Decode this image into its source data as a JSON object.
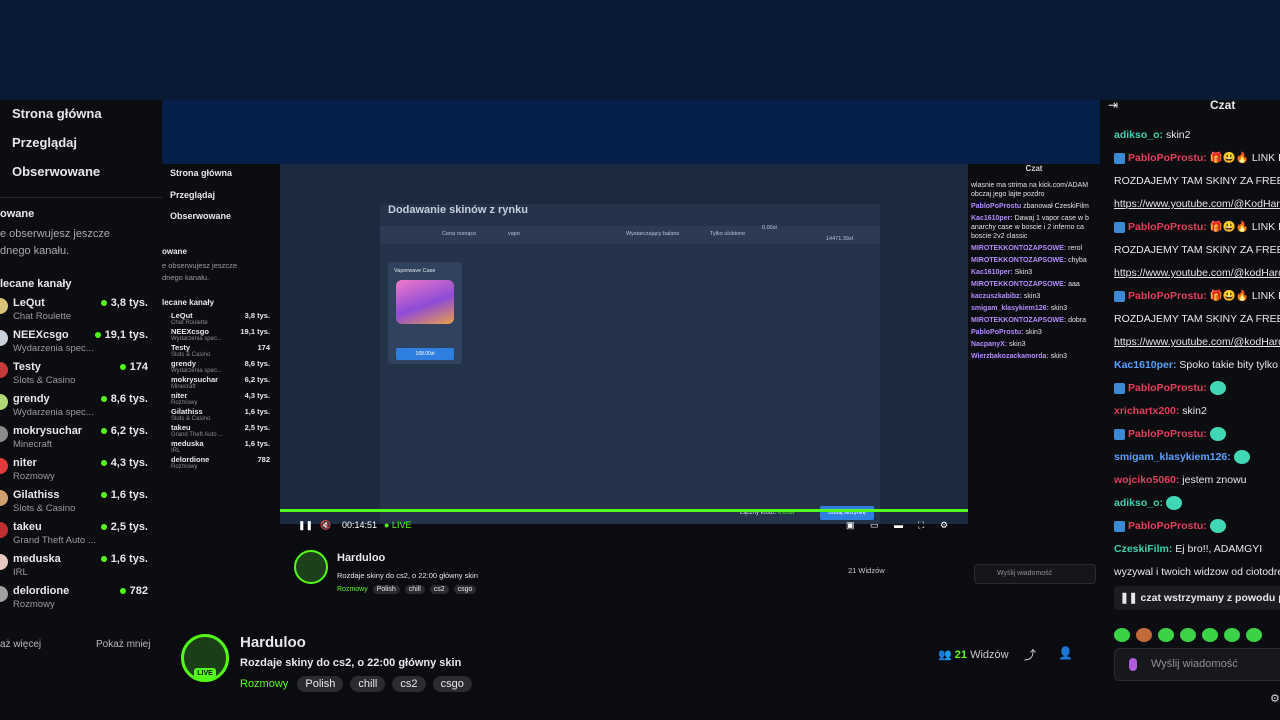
{
  "nav": {
    "home": "Strona główna",
    "browse": "Przeglądaj",
    "following": "Obserwowane"
  },
  "sidebar": {
    "followed_heading": "Obserwowane",
    "followed_empty": "Nie obserwujesz jeszcze żadnego kanału.",
    "followed_empty_line1": "e obserwujesz jeszcze",
    "followed_empty_line2": "dnego kanału.",
    "followed_heading_cut": "owane",
    "recommended_heading": "lecane kanały",
    "show_more": "aż więcej",
    "show_less": "Pokaż mniej",
    "recommended": [
      {
        "name": "LeQut",
        "category": "Chat Roulette",
        "viewers": "3,8 tys.",
        "avatar": "#d8c27a"
      },
      {
        "name": "NEEXcsgo",
        "category": "Wydarzenia spec...",
        "viewers": "19,1 tys.",
        "avatar": "#c9d1db"
      },
      {
        "name": "Testy",
        "category": "Slots & Casino",
        "viewers": "174",
        "avatar": "#c73a3a"
      },
      {
        "name": "grendy",
        "category": "Wydarzenia spec...",
        "viewers": "8,6 tys.",
        "avatar": "#b2d87a"
      },
      {
        "name": "mokrysuchar",
        "category": "Minecraft",
        "viewers": "6,2 tys.",
        "avatar": "#8a8a8a"
      },
      {
        "name": "niter",
        "category": "Rozmowy",
        "viewers": "4,3 tys.",
        "avatar": "#e03a3a"
      },
      {
        "name": "Gilathiss",
        "category": "Slots & Casino",
        "viewers": "1,6 tys.",
        "avatar": "#d0a070"
      },
      {
        "name": "takeu",
        "category": "Grand Theft Auto ...",
        "viewers": "2,5 tys.",
        "avatar": "#c03030"
      },
      {
        "name": "meduska",
        "category": "IRL",
        "viewers": "1,6 tys.",
        "avatar": "#e8c8c0"
      },
      {
        "name": "delordione",
        "category": "Rozmowy",
        "viewers": "782",
        "avatar": "#a0a0a0"
      }
    ]
  },
  "inner": {
    "modal_title": "Dodawanie skinów z rynku",
    "toolbar": [
      "Cena rosnąco",
      "vapo",
      "Wystarczający balans",
      "Tylko ulubione"
    ],
    "slider_min": "0.00zł",
    "slider_max": "14471.39zł",
    "case_name": "Vaporwave Case",
    "case_price": "168.00zł",
    "total_label": "Łączny koszt:",
    "total_value": "0.00zł",
    "add_button": "Dodaj skrzynkę",
    "time": "00:14:51",
    "live": "● LIVE",
    "chat_title": "Czat",
    "chat": [
      {
        "user": "",
        "text": "wlasnie ma strima na kick.com/ADAM obczaj jego lajte pozdro"
      },
      {
        "user": "PabloPoProstu",
        "text": "zbanował CzeskiFilm"
      },
      {
        "user": "Kac1610per:",
        "text": "Dawaj 1 vapor case w b anarchy case w boscie i 2 inferno ca boscie 2v2 classic"
      },
      {
        "user": "MIROTEKKONTOZAPSOWE:",
        "text": "rerol"
      },
      {
        "user": "MIROTEKKONTOZAPSOWE:",
        "text": "chyba"
      },
      {
        "user": "Kac1610per:",
        "text": "Skin3"
      },
      {
        "user": "MIROTEKKONTOZAPSOWE:",
        "text": "aaa"
      },
      {
        "user": "kaczuszkabibz:",
        "text": "skin3"
      },
      {
        "user": "smigam_klasykiem126:",
        "text": "skin3"
      },
      {
        "user": "MIROTEKKONTOZAPSOWE:",
        "text": "dobra"
      },
      {
        "user": "PabloPoProstu:",
        "text": "skin3"
      },
      {
        "user": "NacpanyX:",
        "text": "skin3"
      },
      {
        "user": "Wierzbakozackamorda:",
        "text": "skin3"
      }
    ],
    "chat_placeholder": "Wyślij wiadomość",
    "viewers": "21 Widzów"
  },
  "channel": {
    "name": "Harduloo",
    "title": "Rozdaje skiny do cs2, o 22:00 główny skin",
    "live_badge": "LIVE",
    "category": "Rozmowy",
    "tags": [
      "Polish",
      "chill",
      "cs2",
      "csgo"
    ],
    "viewer_count": "21",
    "viewer_label": "Widzów"
  },
  "chat": {
    "title": "Czat",
    "messages": [
      {
        "user": "adikso_o:",
        "color": "#3ed1b0",
        "text": "skin2",
        "badge": false
      },
      {
        "user": "PabloPoProstu:",
        "color": "#e0405c",
        "text": "🎁😃🔥 LINK DO",
        "badge": true
      },
      {
        "user": "",
        "color": "#e6e6ea",
        "text": "ROZDAJEMY TAM SKINY ZA FREE",
        "badge": false
      },
      {
        "user": "",
        "color": "#e6e6ea",
        "text": "https://www.youtube.com/@KodHard",
        "badge": false,
        "link": true
      },
      {
        "user": "PabloPoProstu:",
        "color": "#e0405c",
        "text": "🎁😃🔥 LINK DO",
        "badge": true
      },
      {
        "user": "",
        "color": "#e6e6ea",
        "text": "ROZDAJEMY TAM SKINY ZA FREE",
        "badge": false
      },
      {
        "user": "",
        "color": "#e6e6ea",
        "text": "https://www.youtube.com/@kodHard",
        "badge": false,
        "link": true
      },
      {
        "user": "PabloPoProstu:",
        "color": "#e0405c",
        "text": "🎁😃🔥 LINK DO",
        "badge": true
      },
      {
        "user": "",
        "color": "#e6e6ea",
        "text": "ROZDAJEMY TAM SKINY ZA FREE",
        "badge": false
      },
      {
        "user": "",
        "color": "#e6e6ea",
        "text": "https://www.youtube.com/@kodHard",
        "badge": false,
        "link": true
      },
      {
        "user": "Kac1610per:",
        "color": "#5aa0ff",
        "text": "Spoko takie bity tylko on",
        "badge": false
      },
      {
        "user": "PabloPoProstu:",
        "color": "#e0405c",
        "text": "",
        "badge": true,
        "emote": true
      },
      {
        "user": "xrichartx200:",
        "color": "#e0405c",
        "text": "skin2",
        "badge": false
      },
      {
        "user": "PabloPoProstu:",
        "color": "#e0405c",
        "text": "",
        "badge": true,
        "emote": true
      },
      {
        "user": "smigam_klasykiem126:",
        "color": "#5aa0ff",
        "text": "",
        "badge": false,
        "emote": true
      },
      {
        "user": "wojciko5060:",
        "color": "#e0405c",
        "text": "jestem znowu",
        "badge": false
      },
      {
        "user": "adikso_o:",
        "color": "#3ed1b0",
        "text": "",
        "badge": false,
        "emote": true
      },
      {
        "user": "PabloPoProstu:",
        "color": "#e0405c",
        "text": "",
        "badge": true,
        "emote": true
      },
      {
        "user": "CzeskiFilm:",
        "color": "#3ed1b0",
        "text": "Ej bro!!, ADAMGYI",
        "badge": false
      },
      {
        "user": "",
        "color": "#e6e6ea",
        "text": "wyzywal i twoich widzow od ciotodre",
        "badge": false
      },
      {
        "user": "",
        "color": "#e6e6ea",
        "text": "wlasnie ma strima na kick.com/ADAM",
        "badge": false
      }
    ],
    "paused_banner": "czat wstrzymany z powodu pr",
    "input_placeholder": "Wyślij wiadomość"
  },
  "colors": {
    "accent": "#53fc18",
    "background": "#0b0c10",
    "video_bg": "#06204a"
  }
}
